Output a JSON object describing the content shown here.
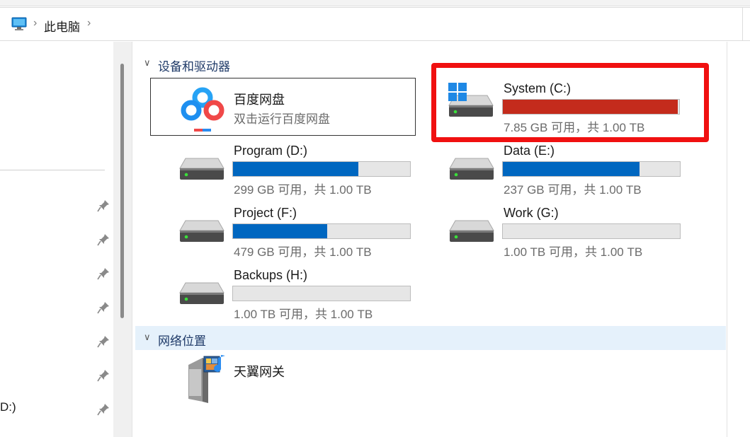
{
  "address_bar": {
    "crumb": "此电脑",
    "pc_icon": "computer-monitor-icon",
    "separator": "›"
  },
  "nav": {
    "pins": [
      "pin-icon",
      "pin-icon",
      "pin-icon",
      "pin-icon",
      "pin-icon",
      "pin-icon",
      "pin-icon"
    ],
    "drive_text": "D:)"
  },
  "sections": {
    "devices_title": "设备和驱动器",
    "network_title": "网络位置",
    "toggle_glyph": "∨"
  },
  "baidu": {
    "name": "百度网盘",
    "subtitle": "双击运行百度网盘"
  },
  "drives": [
    {
      "label": "System (C:)",
      "sub": "7.85 GB 可用，共 1.00 TB",
      "used_fraction": 0.992,
      "color": "#c42b1c",
      "windows_logo": true
    },
    {
      "label": "Program (D:)",
      "sub": "299 GB 可用，共 1.00 TB",
      "used_fraction": 0.708,
      "color": "#0067c0"
    },
    {
      "label": "Data (E:)",
      "sub": "237 GB 可用，共 1.00 TB",
      "used_fraction": 0.772,
      "color": "#0067c0"
    },
    {
      "label": "Project (F:)",
      "sub": "479 GB 可用，共 1.00 TB",
      "used_fraction": 0.532,
      "color": "#0067c0"
    },
    {
      "label": "Work (G:)",
      "sub": "1.00 TB 可用，共 1.00 TB",
      "used_fraction": 0.0,
      "color": "#0067c0"
    },
    {
      "label": "Backups (H:)",
      "sub": "1.00 TB 可用，共 1.00 TB",
      "used_fraction": 0.0,
      "color": "#0067c0"
    }
  ],
  "network": {
    "items": [
      {
        "label": "天翼网关",
        "icon": "media-server-icon"
      }
    ]
  },
  "colors": {
    "highlight": "#f01010",
    "accent": "#0067c0",
    "full_drive": "#c42b1c"
  }
}
